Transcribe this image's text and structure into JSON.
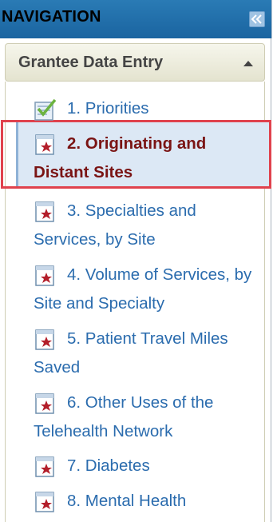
{
  "header": {
    "title": "NAVIGATION",
    "collapse_icon": "double-chevron-left-icon"
  },
  "section": {
    "title": "Grantee Data Entry",
    "toggle_icon": "caret-up-icon"
  },
  "items": [
    {
      "label": "1. Priorities",
      "icon": "checked-document-icon",
      "active": false
    },
    {
      "label": "2. Originating and Distant Sites",
      "icon": "document-star-icon",
      "active": true
    },
    {
      "label": "3. Specialties and Services, by Site",
      "icon": "document-star-icon",
      "active": false
    },
    {
      "label": "4. Volume of Services, by Site and Specialty",
      "icon": "document-star-icon",
      "active": false
    },
    {
      "label": "5. Patient Travel Miles Saved",
      "icon": "document-star-icon",
      "active": false
    },
    {
      "label": "6. Other Uses of the Telehealth Network",
      "icon": "document-star-icon",
      "active": false
    },
    {
      "label": "7. Diabetes",
      "icon": "document-star-icon",
      "active": false
    },
    {
      "label": "8. Mental Health",
      "icon": "document-star-icon",
      "active": false
    }
  ],
  "colors": {
    "header_bg": "#1f6ea7",
    "link": "#2b6cae",
    "active_text": "#7a1414",
    "active_bg": "#dce8f5",
    "highlight_outline": "#e0424d"
  }
}
